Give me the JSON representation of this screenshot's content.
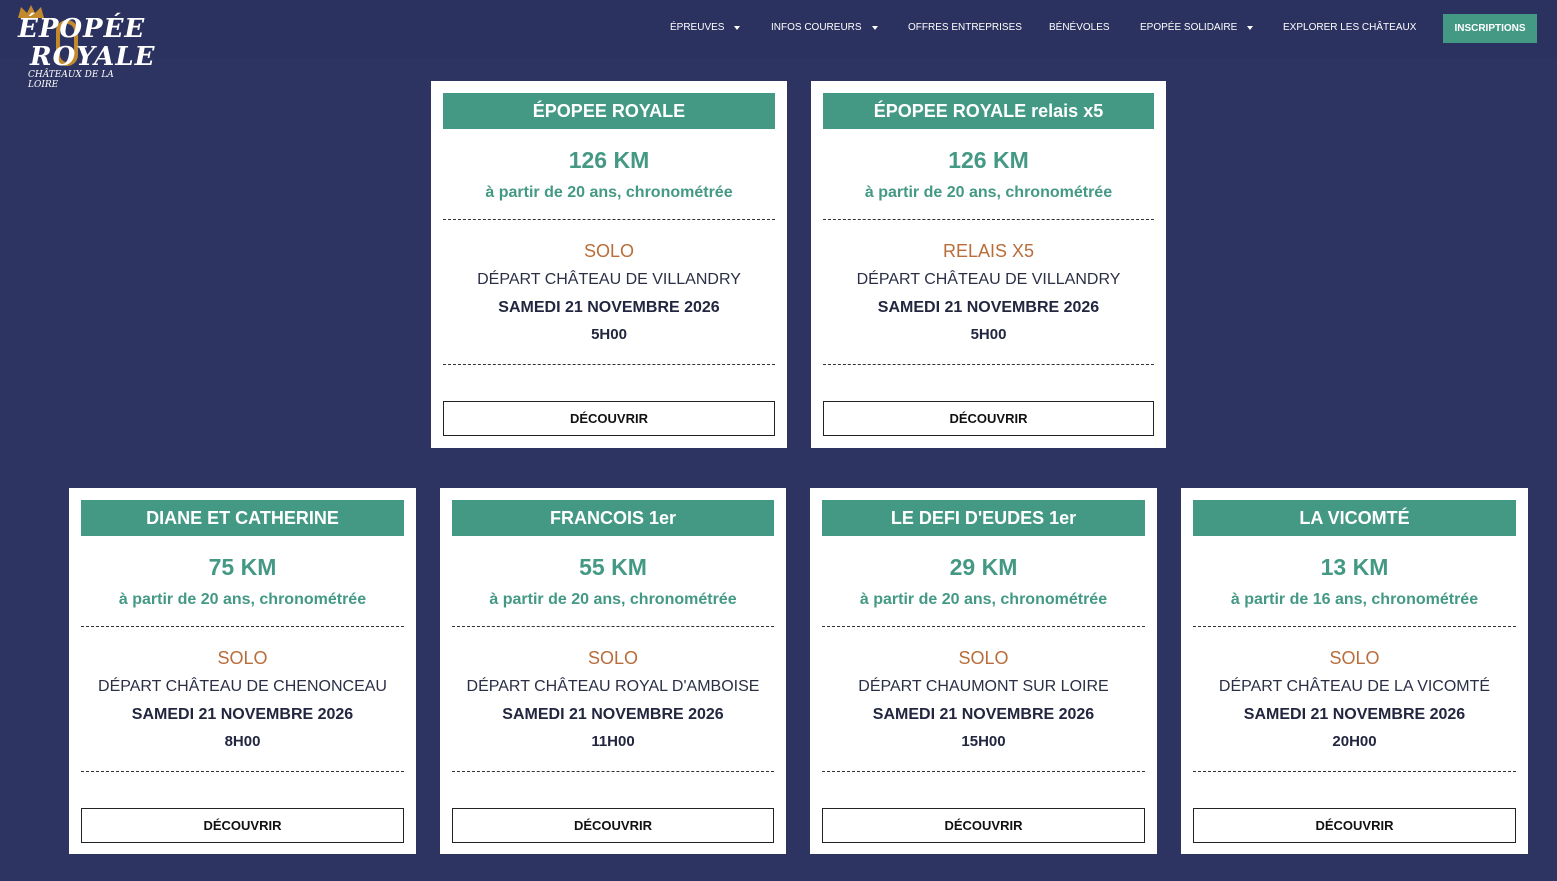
{
  "logo": {
    "line1": "ÉPOPÉE",
    "line2": "ROYALE",
    "tagline": "CHÂTEAUX DE LA LOIRE"
  },
  "nav": {
    "items": [
      {
        "label": "ÉPREUVES",
        "dropdown": true
      },
      {
        "label": "INFOS COUREURS",
        "dropdown": true
      },
      {
        "label": "OFFRES ENTREPRISES",
        "dropdown": false
      },
      {
        "label": "BÉNÉVOLES",
        "dropdown": false
      },
      {
        "label": "EPOPÉE SOLIDAIRE",
        "dropdown": true
      },
      {
        "label": "EXPLORER LES CHÂTEAUX",
        "dropdown": false
      }
    ],
    "cta": "INSCRIPTIONS"
  },
  "colors": {
    "background": "#2e3461",
    "accent": "#449985",
    "mode": "#b86d3a"
  },
  "cards": [
    {
      "title": "ÉPOPEE ROYALE",
      "distance": "126 KM",
      "age": "à partir de 20 ans, chronométrée",
      "mode": "SOLO",
      "depart": "DÉPART CHÂTEAU DE VILLANDRY",
      "date": "SAMEDI 21 NOVEMBRE 2026",
      "time": "5H00",
      "button": "DÉCOUVRIR"
    },
    {
      "title": "ÉPOPEE ROYALE relais x5",
      "distance": "126 KM",
      "age": "à partir de 20 ans, chronométrée",
      "mode": "RELAIS X5",
      "depart": "DÉPART CHÂTEAU DE VILLANDRY",
      "date": "SAMEDI 21 NOVEMBRE 2026",
      "time": "5H00",
      "button": "DÉCOUVRIR"
    },
    {
      "title": "DIANE ET CATHERINE",
      "distance": "75 KM",
      "age": "à partir de 20 ans, chronométrée",
      "mode": "SOLO",
      "depart": "DÉPART CHÂTEAU DE CHENONCEAU",
      "date": "SAMEDI 21 NOVEMBRE 2026",
      "time": "8H00",
      "button": "DÉCOUVRIR"
    },
    {
      "title": "FRANCOIS 1er",
      "distance": "55 KM",
      "age": "à partir de 20 ans, chronométrée",
      "mode": "SOLO",
      "depart": "DÉPART CHÂTEAU ROYAL D'AMBOISE",
      "date": "SAMEDI 21 NOVEMBRE 2026",
      "time": "11H00",
      "button": "DÉCOUVRIR"
    },
    {
      "title": "LE DEFI D'EUDES 1er",
      "distance": "29 KM",
      "age": "à partir de 20 ans, chronométrée",
      "mode": "SOLO",
      "depart": "DÉPART CHAUMONT SUR LOIRE",
      "date": "SAMEDI 21 NOVEMBRE 2026",
      "time": "15H00",
      "button": "DÉCOUVRIR"
    },
    {
      "title": "LA VICOMTÉ",
      "distance": "13 KM",
      "age": "à partir de 16 ans, chronométrée",
      "mode": "SOLO",
      "depart": "DÉPART CHÂTEAU DE LA VICOMTÉ",
      "date": "SAMEDI 21 NOVEMBRE 2026",
      "time": "20H00",
      "button": "DÉCOUVRIR"
    }
  ]
}
